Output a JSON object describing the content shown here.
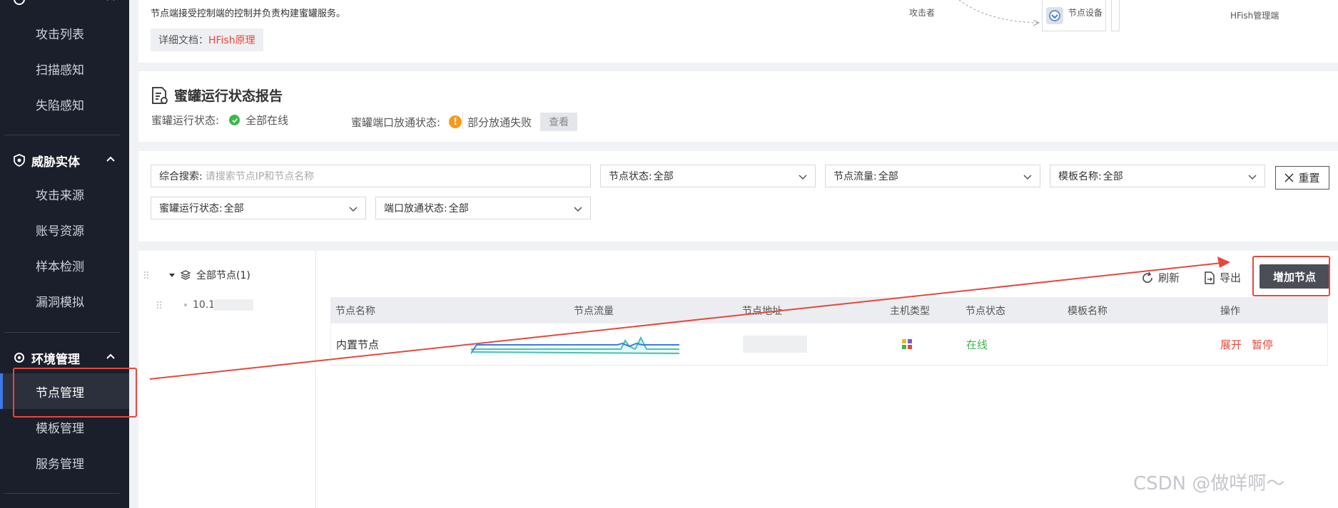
{
  "sidebar": {
    "items_top": [
      "攻击列表",
      "扫描感知",
      "失陷感知"
    ],
    "group_threat": "威胁实体",
    "items_threat": [
      "攻击来源",
      "账号资源",
      "样本检测",
      "漏洞模拟"
    ],
    "group_env": "环境管理",
    "items_env": [
      "节点管理",
      "模板管理",
      "服务管理"
    ]
  },
  "top": {
    "text": "节点端接受控制端的控制并负责构建蜜罐服务。",
    "doc_label": "详细文档：",
    "doc_link": "HFish原理",
    "diagram": {
      "attacker": "攻击者",
      "node_device": "节点设备",
      "manager": "HFish管理端"
    }
  },
  "status": {
    "title": "蜜罐运行状态报告",
    "run_label": "蜜罐运行状态:",
    "run_value": "全部在线",
    "port_label": "蜜罐端口放通状态:",
    "port_value": "部分放通失败",
    "view_button": "查看"
  },
  "filters": {
    "search_label": "综合搜索:",
    "search_placeholder": "请搜索节点IP和节点名称",
    "node_status_label": "节点状态:",
    "node_status_value": "全部",
    "node_flow_label": "节点流量:",
    "node_flow_value": "全部",
    "template_label": "模板名称:",
    "template_value": "全部",
    "reset_button": "重置",
    "honeypot_status_label": "蜜罐运行状态:",
    "honeypot_status_value": "全部",
    "port_status_label": "端口放通状态:",
    "port_status_value": "全部"
  },
  "tree": {
    "root": "全部节点(1)",
    "child": "10.1"
  },
  "toolbar": {
    "refresh": "刷新",
    "export": "导出",
    "add_node": "增加节点"
  },
  "table": {
    "headers": [
      "节点名称",
      "节点流量",
      "节点地址",
      "主机类型",
      "节点状态",
      "模板名称",
      "操作"
    ],
    "rows": [
      {
        "name": "内置节点",
        "status": "在线",
        "actions": [
          "展开",
          "暂停"
        ]
      }
    ]
  },
  "watermark": "CSDN @做咩啊～",
  "colors": {
    "sidebar_bg": "#1b1f2b",
    "accent_red": "#e8473b",
    "online_green": "#3bb848",
    "warn_orange": "#f59a1b",
    "primary_btn": "#4b4d57"
  }
}
